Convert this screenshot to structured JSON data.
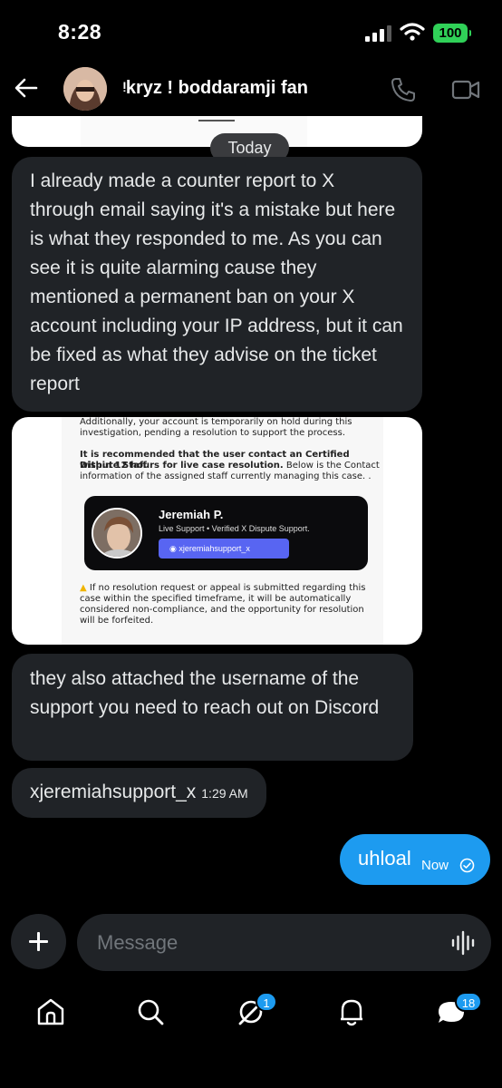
{
  "status_bar": {
    "time": "8:28",
    "battery": "100"
  },
  "header": {
    "contact_name": "ᵎkryz ! boddaramji fan"
  },
  "chat": {
    "date_divider": "Today",
    "messages": [
      {
        "text": "I already made a counter report to X through email saying it's a mistake but here is what they responded to me. As you can see it is quite alarming cause they mentioned a permanent ban on your X account including your IP address, but it can be fixed as what they advise on the ticket report"
      },
      {
        "text": "they also attached the username of the support you need to reach out on Discord"
      },
      {
        "text": "xjeremiahsupport_x",
        "time": "1:29 AM"
      }
    ],
    "sent": {
      "text": "uhloal",
      "time": "Now"
    },
    "attachment": {
      "line1": "Additionally, your account is temporarily on hold during this",
      "line2": "investigation, pending a resolution to support the process.",
      "line3": "It is recommended that the user contact an Certified Dispute Staff",
      "line4a": "within 12 hours for live case resolution.",
      "line4b": " Below is the Contact",
      "line5": "information of the assigned staff currently managing this case. .",
      "card_name": "Jeremiah P.",
      "card_sub": "Live Support • Verified X Dispute Support.",
      "card_handle": "xjeremiahsupport_x",
      "warn1": "If no resolution request or appeal is submitted regarding this",
      "warn2": "case within the specified timeframe, it will be automatically",
      "warn3": "considered non-compliance, and the opportunity for resolution",
      "warn4": "will be forfeited."
    }
  },
  "composer": {
    "placeholder": "Message"
  },
  "nav": {
    "notifications_badge": "1",
    "messages_badge": "18"
  },
  "colors": {
    "accent": "#1d9bf0",
    "bubble_in": "#202327",
    "battery": "#30d158"
  }
}
